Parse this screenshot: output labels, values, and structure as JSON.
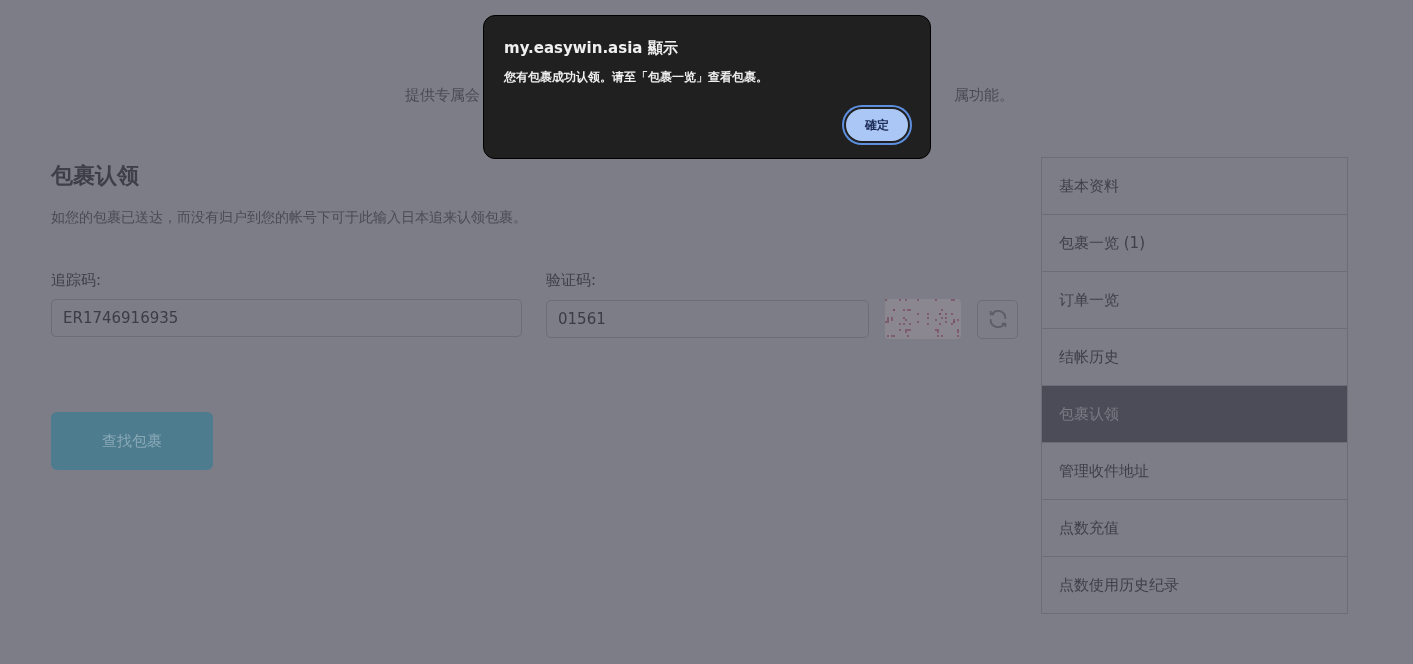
{
  "page_intro": {
    "left": "提供专属会",
    "right": "属功能。"
  },
  "claim": {
    "title": "包裹认领",
    "description": "如您的包裹已送达，而没有归户到您的帐号下可于此输入日本追来认领包裹。",
    "tracking": {
      "label": "追踪码:",
      "value": "ER1746916935"
    },
    "captcha": {
      "label": "验证码:",
      "value": "01561"
    },
    "submit": "查找包裹"
  },
  "sidebar": {
    "items": [
      {
        "label": "基本资料",
        "selected": false
      },
      {
        "label": "包裹一览 (1)",
        "selected": false
      },
      {
        "label": "订单一览",
        "selected": false
      },
      {
        "label": "结帐历史",
        "selected": false
      },
      {
        "label": "包裹认领",
        "selected": true
      },
      {
        "label": "管理收件地址",
        "selected": false
      },
      {
        "label": "点数充值",
        "selected": false
      },
      {
        "label": "点数使用历史纪录",
        "selected": false
      }
    ]
  },
  "dialog": {
    "title": "my.easywin.asia 顯示",
    "message": "您有包裹成功认领。请至「包裹一览」查看包裹。",
    "button": "確定"
  }
}
